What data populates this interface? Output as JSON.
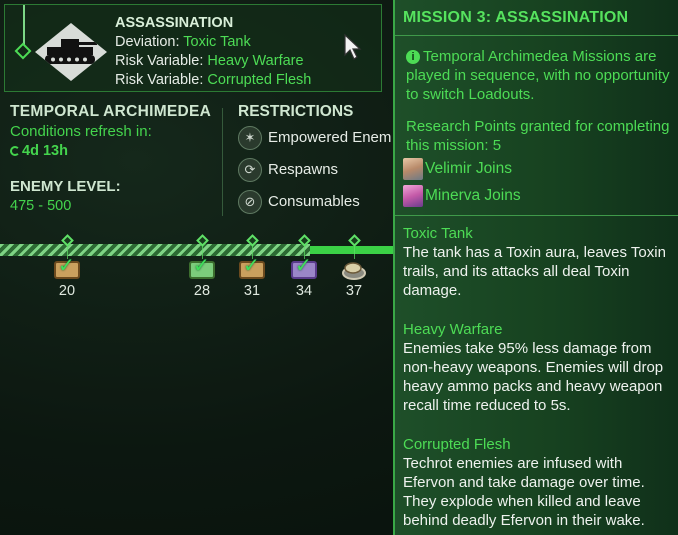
{
  "mission_card": {
    "title": "ASSASSINATION",
    "deviation_label": "Deviation:",
    "deviation_value": "Toxic Tank",
    "risk1_label": "Risk Variable:",
    "risk1_value": "Heavy Warfare",
    "risk2_label": "Risk Variable:",
    "risk2_value": "Corrupted Flesh"
  },
  "archimedea": {
    "title": "TEMPORAL ARCHIMEDEA",
    "conditions_label": "Conditions refresh in:",
    "timer": "4d 13h",
    "enemy_level_title": "ENEMY LEVEL:",
    "enemy_level_range": "475 - 500"
  },
  "restrictions": {
    "title": "RESTRICTIONS",
    "items": [
      {
        "label": "Empowered Enem",
        "icon": "empowered-enemies-icon"
      },
      {
        "label": "Respawns",
        "icon": "respawns-icon"
      },
      {
        "label": "Consumables",
        "icon": "consumables-icon"
      }
    ]
  },
  "milestones": [
    {
      "value": "20",
      "reward": "chest",
      "claimed": true
    },
    {
      "value": "28",
      "reward": "chest",
      "claimed": true
    },
    {
      "value": "31",
      "reward": "chest",
      "claimed": true
    },
    {
      "value": "34",
      "reward": "chest-purple",
      "claimed": true
    },
    {
      "value": "37",
      "reward": "bundle",
      "claimed": false
    }
  ],
  "tooltip": {
    "title": "MISSION 3: ASSASSINATION",
    "note": "Temporal Archimedea Missions are played in sequence, with no opportunity to switch Loadouts.",
    "research": "Research Points granted for completing this mission: 5",
    "joins": [
      "Velimir Joins",
      "Minerva Joins"
    ],
    "sections": [
      {
        "header": "Toxic Tank",
        "body": "The tank has a Toxin aura, leaves Toxin trails, and its attacks all deal Toxin damage."
      },
      {
        "header": "Heavy Warfare",
        "body": "Enemies take 95% less damage from non-heavy weapons. Enemies will drop heavy ammo packs and heavy weapon recall time reduced to 5s."
      },
      {
        "header": "Corrupted Flesh",
        "body": "Techrot enemies are infused with Efervon and take damage over time. They explode when killed and leave behind deadly Efervon in their wake."
      }
    ]
  },
  "colors": {
    "accent": "#4ddc55",
    "panel_bg": "#1e4f29",
    "track_solid": "#3bd146"
  }
}
